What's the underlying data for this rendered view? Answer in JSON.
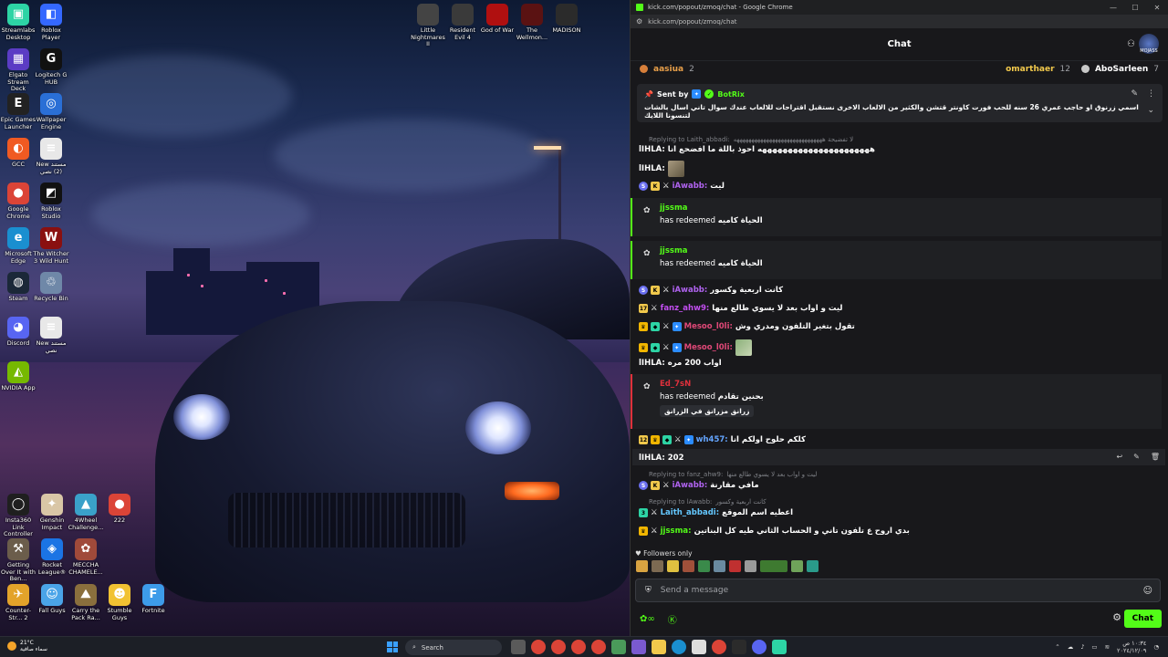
{
  "desktop": {
    "icons": [
      {
        "label": "Streamlabs Desktop",
        "color": "#2dd4a5",
        "glyph": "▣"
      },
      {
        "label": "Roblox Player",
        "color": "#3468ff",
        "glyph": "◧"
      },
      {
        "label": "Elgato Stream Deck",
        "color": "#5b3cc4",
        "glyph": "▦"
      },
      {
        "label": "Logitech G HUB",
        "color": "#111111",
        "glyph": "G"
      },
      {
        "label": "Epic Games Launcher",
        "color": "#222222",
        "glyph": "E"
      },
      {
        "label": "Wallpaper Engine",
        "color": "#2a6fd6",
        "glyph": "◎"
      },
      {
        "label": "GCC",
        "color": "#f05a22",
        "glyph": "◐"
      },
      {
        "label": "New مستند (2) نصي",
        "color": "#e8e8e8",
        "glyph": "≡"
      },
      {
        "label": "Google Chrome",
        "color": "#db4437",
        "glyph": "●"
      },
      {
        "label": "Roblox Studio",
        "color": "#111111",
        "glyph": "◩"
      },
      {
        "label": "Microsoft Edge",
        "color": "#1a8fd0",
        "glyph": "e"
      },
      {
        "label": "The Witcher 3 Wild Hunt",
        "color": "#8a1010",
        "glyph": "W"
      },
      {
        "label": "Steam",
        "color": "#1b2838",
        "glyph": "◍"
      },
      {
        "label": "Recycle Bin",
        "color": "#6f88a8",
        "glyph": "♲"
      },
      {
        "label": "Discord",
        "color": "#5865f2",
        "glyph": "◕"
      },
      {
        "label": "New مستند نصي",
        "color": "#e8e8e8",
        "glyph": "≡"
      },
      {
        "label": "NVIDIA App",
        "color": "#76b900",
        "glyph": "◭"
      },
      {
        "label": "Insta360 Link Controller",
        "color": "#1f1f1f",
        "glyph": "◯"
      },
      {
        "label": "Genshin Impact",
        "color": "#d9c6a6",
        "glyph": "✦"
      },
      {
        "label": "4Wheel Challenge...",
        "color": "#3aa1c9",
        "glyph": "▲"
      },
      {
        "label": "222",
        "color": "#db4437",
        "glyph": "●"
      },
      {
        "label": "Getting Over It with Ben...",
        "color": "#6b5d4b",
        "glyph": "⚒"
      },
      {
        "label": "Rocket League®",
        "color": "#1b74e4",
        "glyph": "◈"
      },
      {
        "label": "MECCHA CHAMELE...",
        "color": "#a04a3a",
        "glyph": "✿"
      },
      {
        "label": "Counter-Str... 2",
        "color": "#e3a32a",
        "glyph": "✈"
      },
      {
        "label": "Fall Guys",
        "color": "#4aa4e8",
        "glyph": "☺"
      },
      {
        "label": "Carry the Pack Ra...",
        "color": "#8a6f3d",
        "glyph": "⛰"
      },
      {
        "label": "Stumble Guys",
        "color": "#f1c232",
        "glyph": "☻"
      },
      {
        "label": "Fortnite",
        "color": "#3d9be9",
        "glyph": "F"
      }
    ],
    "top_icons": [
      {
        "label": "Little Nightmares II",
        "color": "#444444"
      },
      {
        "label": "Resident Evil 4",
        "color": "#3a3a3a"
      },
      {
        "label": "God of War",
        "color": "#b01010"
      },
      {
        "label": "The Wellmon...",
        "color": "#5a1212"
      },
      {
        "label": "MADISON",
        "color": "#2b2b2b"
      }
    ]
  },
  "browser": {
    "window_title": "kick.com/popout/zmoq/chat - Google Chrome",
    "url": "kick.com/popout/zmoq/chat",
    "chat_title": "Chat",
    "avatar_text": "MOJASS",
    "leaderboard": [
      {
        "name": "aasiua",
        "count": "2",
        "color": "#e9a04a",
        "coin": "#d77f3a"
      },
      {
        "name": "omarthaer",
        "count": "12",
        "color": "#f2c94c",
        "coin": "#f2b600"
      },
      {
        "name": "AboSarleen",
        "count": "7",
        "color": "#ffffff",
        "coin": "#c8c8c8"
      }
    ],
    "pinned": {
      "sent_by_label": "Sent by",
      "sender": "BotRix",
      "sender_color": "#53fc18",
      "message": "اسمي زرنوق او حاجب عمري 26 سنه للحب فورت كاونتر قتشن والكثير من الالعاب الاخرى نستقبل اقتراحات للالعاب عندك سوال تاني اسال بالشات لتنسونا اللايك"
    },
    "messages": {
      "reply1_label": "Replying to Laith_abbadi:",
      "reply1_text": "لا تفضيحة ههههههههههههههههههههههههههههههه",
      "m1_user": "lIHLA:",
      "m1_text": "ههههههههههههههههههههههه احوذ باللة ما افضحع انا",
      "m2_user": "lIHLA:",
      "m3_user": "iAwabb:",
      "m3_text": "ليت",
      "r1_user": "jjssma",
      "r1_text": "has redeemed",
      "r1_reward": "الحياة كاميه",
      "r2_user": "jjssma",
      "r2_text": "has redeemed",
      "r2_reward": "الحياة كاميه",
      "m4_user": "iAwabb:",
      "m4_text": "كانت اربعية وكسور",
      "m5_user": "fanz_ahw9:",
      "m5_text": "ليت و اواب بعد لا يسوي طالع منها",
      "m6_user": "Mesoo_l0li:",
      "m6_text": "تقول بتغير التلفون ومدري وش",
      "m7_user": "Mesoo_l0li:",
      "m8_user": "lIHLA:",
      "m8_text": "اواب 200 مره",
      "r3_user": "Ed_7sN",
      "r3_text": "has redeemed",
      "r3_reward": "بحنين تقادم",
      "r3_sub": "زرانق مزرانق في الزرانق",
      "m9_user": "wh457:",
      "m9_text": "كلكم حلوح اولكم انا",
      "m10_user": "lIHLA:",
      "m10_text": "202",
      "reply2_label": "Replying to fanz_ahw9:",
      "reply2_text": "ليت و اواب بعد لا يسوي طالع منها",
      "m11_user": "iAwabb:",
      "m11_text": "مافي مقارنة",
      "reply3_label": "Replying to lAwabb:",
      "reply3_text": "كانت اربعية وكسور",
      "m12_user": "Laith_abbadi:",
      "m12_text": "اعطيه اسم الموقع",
      "m13_user": "jjssma:",
      "m13_text": "بدي اروح ع تلفون تاني و الحساب الثاني طيه كل البناتين"
    },
    "user_colors": {
      "lihla": "#ffffff",
      "iawabb": "#b063f0",
      "jjssma": "#53fc18",
      "fanz": "#c24ef0",
      "mesoo": "#e04878",
      "ed7sn": "#e0303c",
      "wh457": "#64a5ff",
      "laith": "#64c8ff"
    },
    "followers_label": "Followers only",
    "input_placeholder": "Send a message",
    "chat_button": "Chat"
  },
  "taskbar": {
    "temp": "21°C",
    "weather_text": "سماء صافية",
    "search_label": "Search",
    "time": "١٠:٣٤ ص",
    "date": "٢٠٢٤/١٢/٠٩"
  }
}
